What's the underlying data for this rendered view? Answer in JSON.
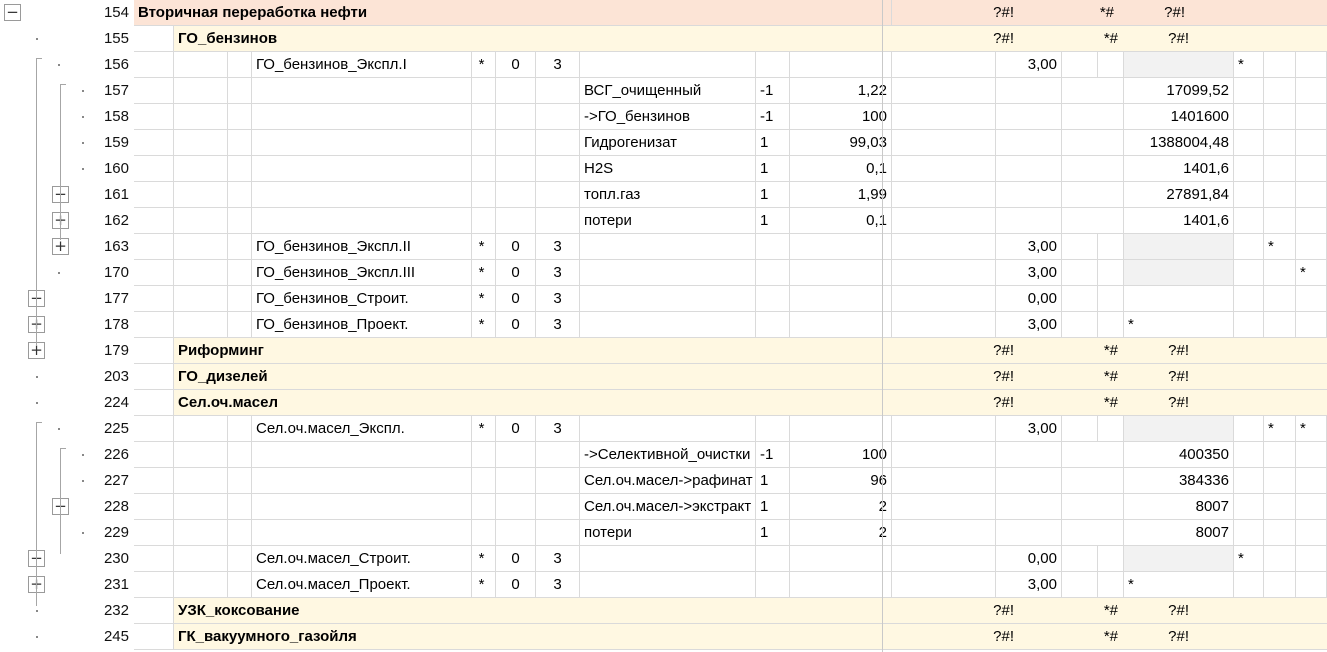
{
  "colors": {
    "header_pink": "#fce4d6",
    "group_yellow": "#fff8e2",
    "empty_grey": "#f2f2f2",
    "gridline": "#dadada"
  },
  "outline_buttons": [
    {
      "row": 0,
      "level": 0,
      "symbol": "−"
    },
    {
      "row": 7,
      "level": 2,
      "symbol": "−"
    },
    {
      "row": 8,
      "level": 2,
      "symbol": "+"
    },
    {
      "row": 9,
      "level": 2,
      "symbol": "+"
    },
    {
      "row": 11,
      "level": 1,
      "symbol": "−"
    },
    {
      "row": 12,
      "level": 1,
      "symbol": "+"
    },
    {
      "row": 13,
      "level": 1,
      "symbol": "+"
    },
    {
      "row": 19,
      "level": 2,
      "symbol": "−"
    },
    {
      "row": 21,
      "level": 1,
      "symbol": "−"
    },
    {
      "row": 22,
      "level": 1,
      "symbol": "+"
    }
  ],
  "rows": [
    {
      "num": "154",
      "kind": "header",
      "title": "Вторичная переработка нефти",
      "flags": [
        "?#!",
        "*#",
        "?#!"
      ]
    },
    {
      "num": "155",
      "kind": "group",
      "title": "ГО_бензинов",
      "flags": [
        "?#!",
        "*#",
        "?#!"
      ]
    },
    {
      "num": "156",
      "kind": "unit",
      "name": "ГО_бензинов_Экспл.I",
      "a": "*",
      "b": "0",
      "c": "3",
      "k": "3,00",
      "star": "*",
      "star_col": 1
    },
    {
      "num": "157",
      "kind": "item",
      "name": "ВСГ_очищенный",
      "sign": "-1",
      "pct": "1,22",
      "val": "17099,52"
    },
    {
      "num": "158",
      "kind": "item",
      "name": "->ГО_бензинов",
      "sign": "-1",
      "pct": "100",
      "val": "1401600"
    },
    {
      "num": "159",
      "kind": "item",
      "name": "Гидрогенизат",
      "sign": "1",
      "pct": "99,03",
      "val": "1388004,48"
    },
    {
      "num": "160",
      "kind": "item",
      "name": "H2S",
      "sign": "1",
      "pct": "0,1",
      "val": "1401,6"
    },
    {
      "num": "161",
      "kind": "item",
      "name": "топл.газ",
      "sign": "1",
      "pct": "1,99",
      "val": "27891,84"
    },
    {
      "num": "162",
      "kind": "item",
      "name": "потери",
      "sign": "1",
      "pct": "0,1",
      "val": "1401,6"
    },
    {
      "num": "163",
      "kind": "unit",
      "name": "ГО_бензинов_Экспл.II",
      "a": "*",
      "b": "0",
      "c": "3",
      "k": "3,00",
      "star": "*",
      "star_col": 2
    },
    {
      "num": "170",
      "kind": "unit",
      "name": "ГО_бензинов_Экспл.III",
      "a": "*",
      "b": "0",
      "c": "3",
      "k": "3,00",
      "star": "*",
      "star_col": 3
    },
    {
      "num": "177",
      "kind": "unit",
      "name": "ГО_бензинов_Строит.",
      "a": "*",
      "b": "0",
      "c": "3",
      "k": "0,00",
      "star": "",
      "star_col": 0
    },
    {
      "num": "178",
      "kind": "unit",
      "name": "ГО_бензинов_Проект.",
      "a": "*",
      "b": "0",
      "c": "3",
      "k": "3,00",
      "star": "*",
      "star_col": 0
    },
    {
      "num": "179",
      "kind": "group",
      "title": "Риформинг",
      "flags": [
        "?#!",
        "*#",
        "?#!"
      ]
    },
    {
      "num": "203",
      "kind": "group",
      "title": "ГО_дизелей",
      "flags": [
        "?#!",
        "*#",
        "?#!"
      ]
    },
    {
      "num": "224",
      "kind": "group",
      "title": "Сел.оч.масел",
      "flags": [
        "?#!",
        "*#",
        "?#!"
      ]
    },
    {
      "num": "225",
      "kind": "unit",
      "name": "Сел.оч.масел_Экспл.",
      "a": "*",
      "b": "0",
      "c": "3",
      "k": "3,00",
      "star": "*",
      "star2": "*",
      "star_col": 2
    },
    {
      "num": "226",
      "kind": "item",
      "name": "->Селективной_очистки",
      "sign": "-1",
      "pct": "100",
      "val": "400350"
    },
    {
      "num": "227",
      "kind": "item",
      "name": "Сел.оч.масел->рафинат",
      "sign": "1",
      "pct": "96",
      "val": "384336"
    },
    {
      "num": "228",
      "kind": "item",
      "name": "Сел.оч.масел->экстракт",
      "sign": "1",
      "pct": "2",
      "val": "8007"
    },
    {
      "num": "229",
      "kind": "item",
      "name": "потери",
      "sign": "1",
      "pct": "2",
      "val": "8007"
    },
    {
      "num": "230",
      "kind": "unit",
      "name": "Сел.оч.масел_Строит.",
      "a": "*",
      "b": "0",
      "c": "3",
      "k": "0,00",
      "star": "*",
      "star_col": 1
    },
    {
      "num": "231",
      "kind": "unit",
      "name": "Сел.оч.масел_Проект.",
      "a": "*",
      "b": "0",
      "c": "3",
      "k": "3,00",
      "star": "*",
      "star_col": 0
    },
    {
      "num": "232",
      "kind": "group",
      "title": "УЗК_коксование",
      "flags": [
        "?#!",
        "*#",
        "?#!"
      ]
    },
    {
      "num": "245",
      "kind": "group",
      "title": "ГК_вакуумного_газойля",
      "flags": [
        "?#!",
        "*#",
        "?#!"
      ]
    }
  ]
}
